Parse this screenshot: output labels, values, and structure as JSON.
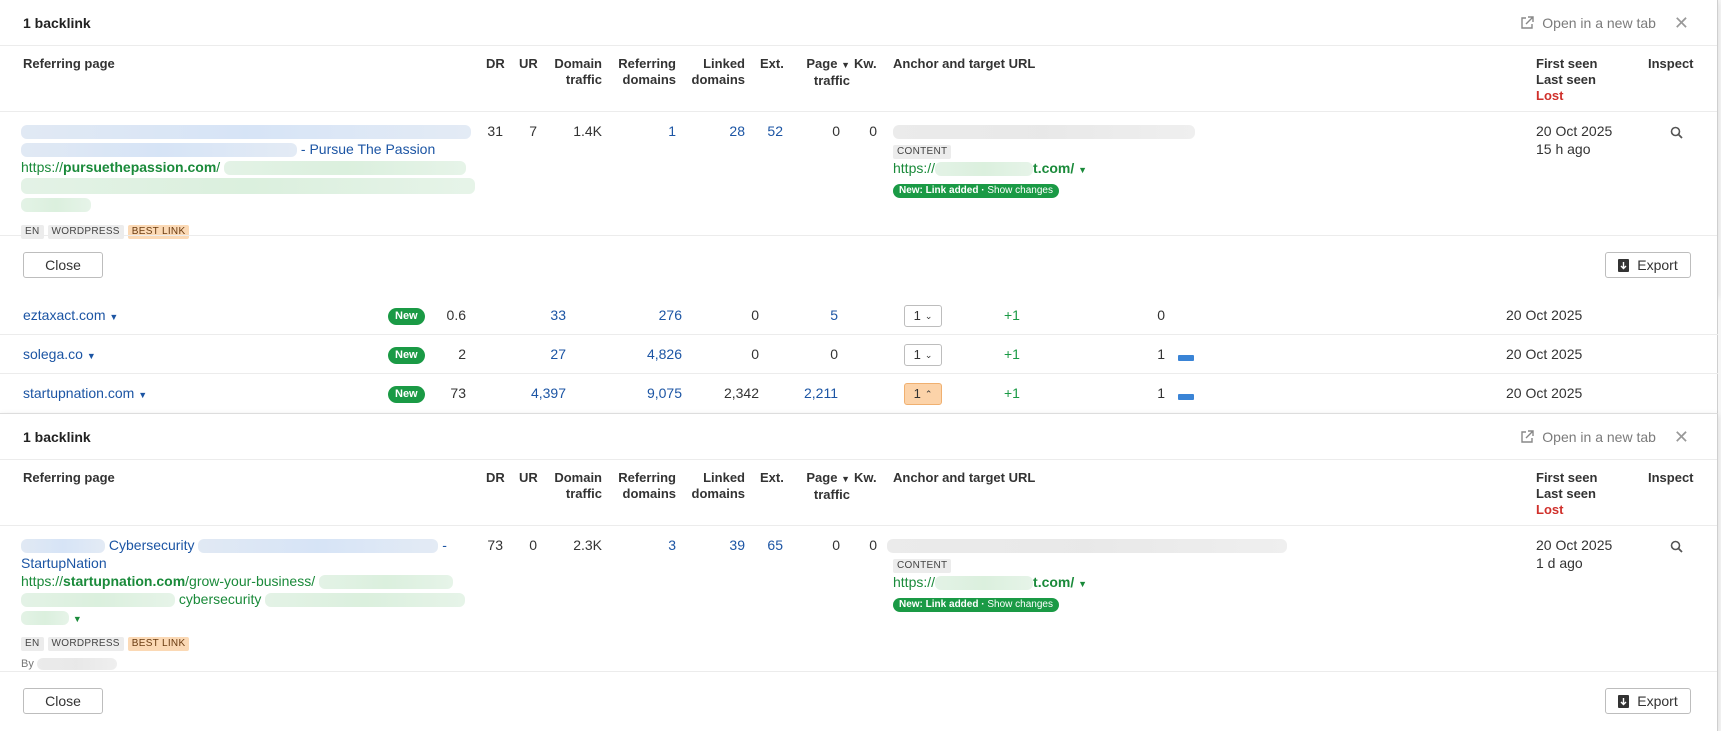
{
  "panel1": {
    "title": "1 backlink",
    "open_new_tab": "Open in a new tab",
    "headers": {
      "referring_page": "Referring page",
      "dr": "DR",
      "ur": "UR",
      "domain_traffic_1": "Domain",
      "domain_traffic_2": "traffic",
      "referring_domains_1": "Referring",
      "referring_domains_2": "domains",
      "linked_domains_1": "Linked",
      "linked_domains_2": "domains",
      "ext": "Ext.",
      "page_traffic_1": "Page",
      "page_traffic_2": "traffic",
      "kw": "Kw.",
      "anchor": "Anchor and target URL",
      "first_seen": "First seen",
      "last_seen": "Last seen",
      "lost": "Lost",
      "inspect": "Inspect"
    },
    "row": {
      "title_suffix": "- Pursue The Passion",
      "url_prefix": "https://",
      "url_domain": "pursuethepassion.com",
      "url_path": "/",
      "tags": [
        "EN",
        "WORDPRESS",
        "BEST LINK"
      ],
      "dr": "31",
      "ur": "7",
      "domain_traffic": "1.4K",
      "referring_domains": "1",
      "linked_domains": "28",
      "ext": "52",
      "page_traffic": "0",
      "kw": "0",
      "content_tag": "CONTENT",
      "target_prefix": "https://",
      "target_suffix": "t.com/",
      "new_link": "New: Link added",
      "show_changes": "Show changes",
      "first_seen": "20 Oct 2025",
      "last_seen": "15 h ago"
    },
    "close_label": "Close",
    "export_label": "Export"
  },
  "domains": {
    "rows": [
      {
        "domain": "eztaxact.com",
        "badge": "New",
        "dr": "0.6",
        "a": "33",
        "b": "276",
        "c": "0",
        "d": "5",
        "links": "1",
        "change": "+1",
        "e": "0",
        "date": "20 Oct 2025",
        "bar": false,
        "active": false
      },
      {
        "domain": "solega.co",
        "badge": "New",
        "dr": "2",
        "a": "27",
        "b": "4,826",
        "c": "0",
        "d": "0",
        "links": "1",
        "change": "+1",
        "e": "1",
        "date": "20 Oct 2025",
        "bar": true,
        "active": false
      },
      {
        "domain": "startupnation.com",
        "badge": "New",
        "dr": "73",
        "a": "4,397",
        "b": "9,075",
        "c": "2,342",
        "d": "2,211",
        "links": "1",
        "change": "+1",
        "e": "1",
        "date": "20 Oct 2025",
        "bar": true,
        "active": true
      }
    ]
  },
  "panel2": {
    "title": "1 backlink",
    "open_new_tab": "Open in a new tab",
    "row": {
      "title_mid": "Cybersecurity",
      "title_dash": "-",
      "title_line2": "StartupNation",
      "url_prefix": "https://",
      "url_domain": "startupnation.com",
      "url_path": "/grow-your-business/",
      "url_word": "cybersecurity",
      "tags": [
        "EN",
        "WORDPRESS",
        "BEST LINK"
      ],
      "by": "By",
      "dr": "73",
      "ur": "0",
      "domain_traffic": "2.3K",
      "referring_domains": "3",
      "linked_domains": "39",
      "ext": "65",
      "page_traffic": "0",
      "kw": "0",
      "content_tag": "CONTENT",
      "target_prefix": "https://",
      "target_suffix": "t.com/",
      "new_link": "New: Link added",
      "show_changes": "Show changes",
      "first_seen": "20 Oct 2025",
      "last_seen": "1 d ago"
    },
    "close_label": "Close",
    "export_label": "Export"
  },
  "colors": {
    "link": "#1c55a4",
    "green": "#1a8a3a",
    "new_badge": "#1a9a45",
    "lost": "#d0302b",
    "best_link_tag": "#fbd9b5",
    "bar": "#3a84d6"
  }
}
